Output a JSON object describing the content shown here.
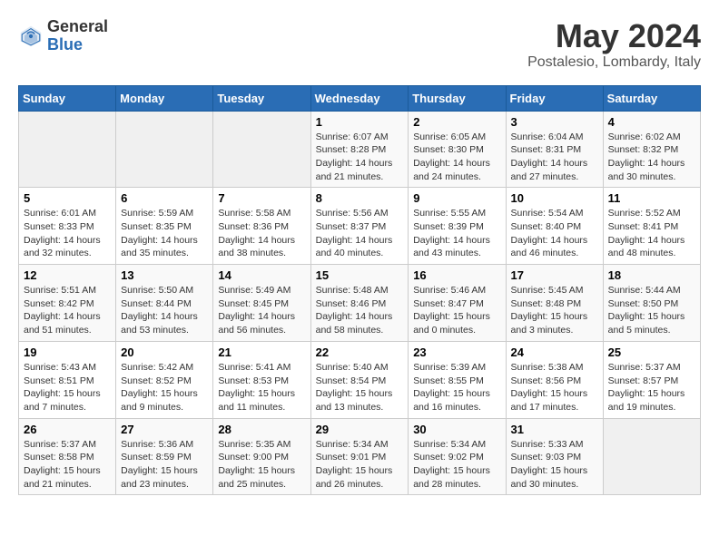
{
  "header": {
    "logo_general": "General",
    "logo_blue": "Blue",
    "title": "May 2024",
    "subtitle": "Postalesio, Lombardy, Italy"
  },
  "columns": [
    "Sunday",
    "Monday",
    "Tuesday",
    "Wednesday",
    "Thursday",
    "Friday",
    "Saturday"
  ],
  "weeks": [
    {
      "days": [
        {
          "num": "",
          "info": ""
        },
        {
          "num": "",
          "info": ""
        },
        {
          "num": "",
          "info": ""
        },
        {
          "num": "1",
          "info": "Sunrise: 6:07 AM\nSunset: 8:28 PM\nDaylight: 14 hours and 21 minutes."
        },
        {
          "num": "2",
          "info": "Sunrise: 6:05 AM\nSunset: 8:30 PM\nDaylight: 14 hours and 24 minutes."
        },
        {
          "num": "3",
          "info": "Sunrise: 6:04 AM\nSunset: 8:31 PM\nDaylight: 14 hours and 27 minutes."
        },
        {
          "num": "4",
          "info": "Sunrise: 6:02 AM\nSunset: 8:32 PM\nDaylight: 14 hours and 30 minutes."
        }
      ]
    },
    {
      "days": [
        {
          "num": "5",
          "info": "Sunrise: 6:01 AM\nSunset: 8:33 PM\nDaylight: 14 hours and 32 minutes."
        },
        {
          "num": "6",
          "info": "Sunrise: 5:59 AM\nSunset: 8:35 PM\nDaylight: 14 hours and 35 minutes."
        },
        {
          "num": "7",
          "info": "Sunrise: 5:58 AM\nSunset: 8:36 PM\nDaylight: 14 hours and 38 minutes."
        },
        {
          "num": "8",
          "info": "Sunrise: 5:56 AM\nSunset: 8:37 PM\nDaylight: 14 hours and 40 minutes."
        },
        {
          "num": "9",
          "info": "Sunrise: 5:55 AM\nSunset: 8:39 PM\nDaylight: 14 hours and 43 minutes."
        },
        {
          "num": "10",
          "info": "Sunrise: 5:54 AM\nSunset: 8:40 PM\nDaylight: 14 hours and 46 minutes."
        },
        {
          "num": "11",
          "info": "Sunrise: 5:52 AM\nSunset: 8:41 PM\nDaylight: 14 hours and 48 minutes."
        }
      ]
    },
    {
      "days": [
        {
          "num": "12",
          "info": "Sunrise: 5:51 AM\nSunset: 8:42 PM\nDaylight: 14 hours and 51 minutes."
        },
        {
          "num": "13",
          "info": "Sunrise: 5:50 AM\nSunset: 8:44 PM\nDaylight: 14 hours and 53 minutes."
        },
        {
          "num": "14",
          "info": "Sunrise: 5:49 AM\nSunset: 8:45 PM\nDaylight: 14 hours and 56 minutes."
        },
        {
          "num": "15",
          "info": "Sunrise: 5:48 AM\nSunset: 8:46 PM\nDaylight: 14 hours and 58 minutes."
        },
        {
          "num": "16",
          "info": "Sunrise: 5:46 AM\nSunset: 8:47 PM\nDaylight: 15 hours and 0 minutes."
        },
        {
          "num": "17",
          "info": "Sunrise: 5:45 AM\nSunset: 8:48 PM\nDaylight: 15 hours and 3 minutes."
        },
        {
          "num": "18",
          "info": "Sunrise: 5:44 AM\nSunset: 8:50 PM\nDaylight: 15 hours and 5 minutes."
        }
      ]
    },
    {
      "days": [
        {
          "num": "19",
          "info": "Sunrise: 5:43 AM\nSunset: 8:51 PM\nDaylight: 15 hours and 7 minutes."
        },
        {
          "num": "20",
          "info": "Sunrise: 5:42 AM\nSunset: 8:52 PM\nDaylight: 15 hours and 9 minutes."
        },
        {
          "num": "21",
          "info": "Sunrise: 5:41 AM\nSunset: 8:53 PM\nDaylight: 15 hours and 11 minutes."
        },
        {
          "num": "22",
          "info": "Sunrise: 5:40 AM\nSunset: 8:54 PM\nDaylight: 15 hours and 13 minutes."
        },
        {
          "num": "23",
          "info": "Sunrise: 5:39 AM\nSunset: 8:55 PM\nDaylight: 15 hours and 16 minutes."
        },
        {
          "num": "24",
          "info": "Sunrise: 5:38 AM\nSunset: 8:56 PM\nDaylight: 15 hours and 17 minutes."
        },
        {
          "num": "25",
          "info": "Sunrise: 5:37 AM\nSunset: 8:57 PM\nDaylight: 15 hours and 19 minutes."
        }
      ]
    },
    {
      "days": [
        {
          "num": "26",
          "info": "Sunrise: 5:37 AM\nSunset: 8:58 PM\nDaylight: 15 hours and 21 minutes."
        },
        {
          "num": "27",
          "info": "Sunrise: 5:36 AM\nSunset: 8:59 PM\nDaylight: 15 hours and 23 minutes."
        },
        {
          "num": "28",
          "info": "Sunrise: 5:35 AM\nSunset: 9:00 PM\nDaylight: 15 hours and 25 minutes."
        },
        {
          "num": "29",
          "info": "Sunrise: 5:34 AM\nSunset: 9:01 PM\nDaylight: 15 hours and 26 minutes."
        },
        {
          "num": "30",
          "info": "Sunrise: 5:34 AM\nSunset: 9:02 PM\nDaylight: 15 hours and 28 minutes."
        },
        {
          "num": "31",
          "info": "Sunrise: 5:33 AM\nSunset: 9:03 PM\nDaylight: 15 hours and 30 minutes."
        },
        {
          "num": "",
          "info": ""
        }
      ]
    }
  ]
}
